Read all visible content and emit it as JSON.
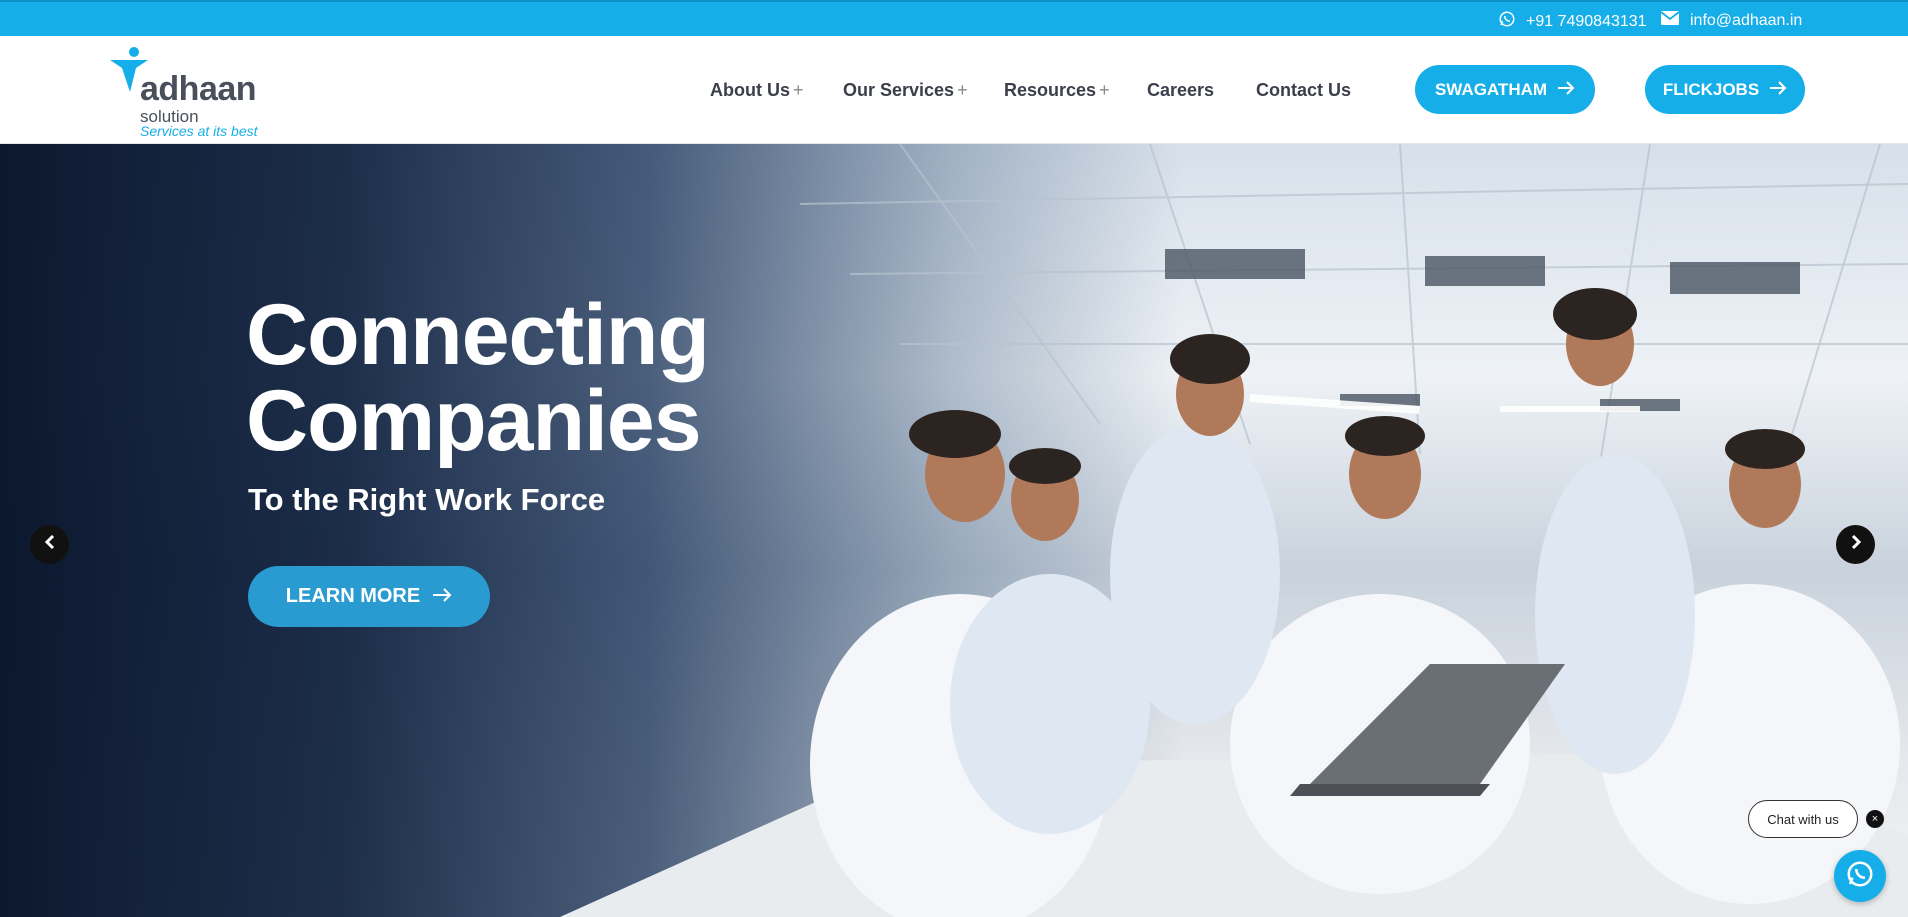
{
  "topbar": {
    "phone": "+91 7490843131",
    "email": "info@adhaan.in",
    "icons": {
      "phone": "whatsapp-icon",
      "email": "mail-icon"
    }
  },
  "logo": {
    "name": "adhaan",
    "sub": "solution",
    "tagline": "Services at its best"
  },
  "nav": {
    "items": [
      {
        "label": "About Us",
        "has_submenu": true
      },
      {
        "label": "Our Services",
        "has_submenu": true
      },
      {
        "label": "Resources",
        "has_submenu": true
      },
      {
        "label": "Careers",
        "has_submenu": false
      },
      {
        "label": "Contact Us",
        "has_submenu": false
      }
    ],
    "plus": "+",
    "buttons": [
      {
        "label": "SWAGATHAM",
        "icon": "arrow-right-icon"
      },
      {
        "label": "FLICKJOBS",
        "icon": "arrow-right-icon"
      }
    ]
  },
  "hero": {
    "headline_line1": "Connecting",
    "headline_line2": "Companies",
    "subline": "To the Right Work Force",
    "cta_label": "LEARN MORE",
    "prev_icon": "chevron-left-icon",
    "next_icon": "chevron-right-icon"
  },
  "chat": {
    "label": "Chat with us",
    "close": "×",
    "icon": "whatsapp-icon"
  },
  "colors": {
    "accent": "#16aee9",
    "cta": "#2a9bd1",
    "nav_text": "#3b3f4a"
  }
}
